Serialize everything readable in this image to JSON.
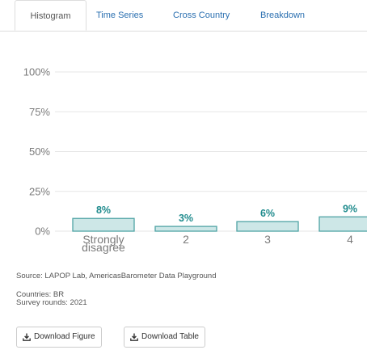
{
  "tabs": [
    {
      "label": "Histogram",
      "active": true
    },
    {
      "label": "Time Series"
    },
    {
      "label": "Cross Country"
    },
    {
      "label": "Breakdown"
    }
  ],
  "chart_data": {
    "type": "bar",
    "categories": [
      "Strongly\ndisagree",
      "2",
      "3",
      "4"
    ],
    "values": [
      8,
      3,
      6,
      9
    ],
    "value_labels": [
      "8%",
      "3%",
      "6%",
      "9%"
    ],
    "ylim": [
      0,
      100
    ],
    "yticks": [
      "0%",
      "25%",
      "50%",
      "75%",
      "100%"
    ],
    "grid": true,
    "colors": {
      "bar_fill": "#cde7e7",
      "bar_stroke": "#4fa3a5",
      "label": "#1f8b8d"
    }
  },
  "captions": {
    "source": "Source: LAPOP Lab, AmericasBarometer Data Playground",
    "countries": "Countries: BR",
    "rounds": "Survey rounds: 2021"
  },
  "buttons": {
    "download_figure": "Download Figure",
    "download_table": "Download Table"
  },
  "icons": {
    "download": "download-icon"
  }
}
